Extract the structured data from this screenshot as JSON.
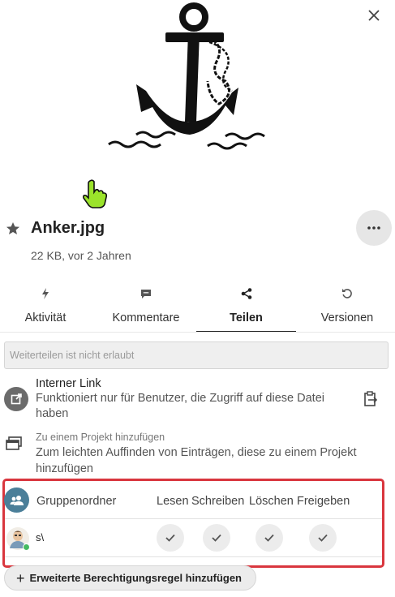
{
  "file": {
    "name": "Anker.jpg",
    "meta": "22 KB, vor 2 Jahren"
  },
  "tabs": [
    {
      "label": "Aktivität",
      "icon": "lightning-icon"
    },
    {
      "label": "Kommentare",
      "icon": "comment-icon"
    },
    {
      "label": "Teilen",
      "icon": "share-icon"
    },
    {
      "label": "Versionen",
      "icon": "history-icon"
    }
  ],
  "active_tab": "Teilen",
  "sharing": {
    "reshare_notice": "Weiterteilen ist nicht erlaubt",
    "internal_link": {
      "title": "Interner Link",
      "description": "Funktioniert nur für Benutzer, die Zugriff auf diese Datei haben"
    },
    "project": {
      "title": "Zu einem Projekt hinzufügen",
      "description": "Zum leichten Auffinden von Einträgen, diese zu einem Projekt hinzufügen"
    }
  },
  "permissions": {
    "group_folder_label": "Gruppenordner",
    "columns": [
      "Lesen",
      "Schreiben",
      "Löschen",
      "Freigeben"
    ],
    "member": {
      "name": "s\\",
      "read": true,
      "write": true,
      "delete": true,
      "share": true
    },
    "add_rule_label": "Erweiterte Berechtigungsregel hinzufügen"
  },
  "colors": {
    "highlight_border": "#d9363e",
    "group_folder_icon": "#4b7f99",
    "online_status": "#46ba61"
  }
}
